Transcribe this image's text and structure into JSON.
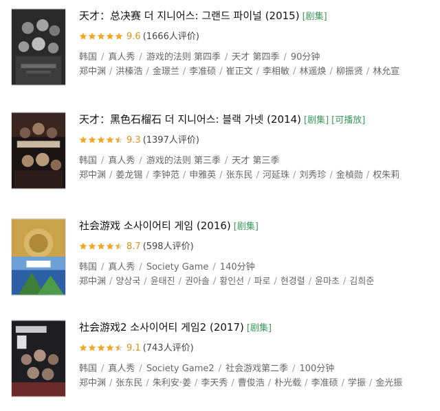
{
  "items": [
    {
      "title": "天才：总决赛 더 지니어스: 그랜드 파이널 (2015)",
      "badges": [
        "剧集"
      ],
      "rating": 5.0,
      "score": "9.6",
      "count": "(1666人评价)",
      "meta": [
        "韩国",
        "真人秀",
        "游戏的法则 第四季",
        "天才 第四季",
        "90分钟"
      ],
      "cast": [
        "郑中渊",
        "洪榛浩",
        "金璟兰",
        "李准硕",
        "崔正文",
        "李相敏",
        "林遥焕",
        "柳振贤",
        "林允宣"
      ],
      "poster_colors": [
        "#2a2a2a",
        "#6b6b6b",
        "#bdbdbd"
      ]
    },
    {
      "title": "天才：黑色石榴石 더 지니어스: 블랙 가넷 (2014)",
      "badges": [
        "剧集",
        "可播放"
      ],
      "rating": 4.5,
      "score": "9.3",
      "count": "(1397人评价)",
      "meta": [
        "韩国",
        "真人秀",
        "游戏的法则 第三季",
        "天才 第三季"
      ],
      "cast": [
        "郑中渊",
        "姜龙锡",
        "李钟范",
        "申雅英",
        "张东民",
        "河延珠",
        "刘秀珍",
        "金楨勋",
        "权朱莉"
      ],
      "poster_colors": [
        "#1a1414",
        "#4a3026",
        "#a88a6a"
      ]
    },
    {
      "title": "社会游戏 소사이어티 게임 (2016)",
      "badges": [
        "剧集"
      ],
      "rating": 4.5,
      "score": "8.7",
      "count": "(598人评价)",
      "meta": [
        "韩国",
        "真人秀",
        "Society Game",
        "140分钟"
      ],
      "cast": [
        "郑中渊",
        "양상국",
        "윤태진",
        "권아솔",
        "황인선",
        "파로",
        "현경렬",
        "윤마초",
        "김희준"
      ],
      "poster_colors": [
        "#c9a24a",
        "#3e7f3a",
        "#2c5fa3"
      ]
    },
    {
      "title": "社会游戏2 소사이어티 게임2 (2017)",
      "badges": [
        "剧集"
      ],
      "rating": 4.5,
      "score": "9.1",
      "count": "(743人评价)",
      "meta": [
        "韩国",
        "真人秀",
        "Society Game2",
        "社会游戏第二季",
        "100分钟"
      ],
      "cast": [
        "郑中渊",
        "张东民",
        "朱利安·姜",
        "李天秀",
        "曹俊浩",
        "朴光载",
        "李准硕",
        "学振",
        "金光振"
      ],
      "poster_colors": [
        "#1e1e22",
        "#6a2a2a",
        "#c8c8c8"
      ]
    }
  ],
  "colors": {
    "star": "#f5a623",
    "star_empty": "#dddddd",
    "score": "#e09015",
    "badge": "#3a9a5a"
  }
}
